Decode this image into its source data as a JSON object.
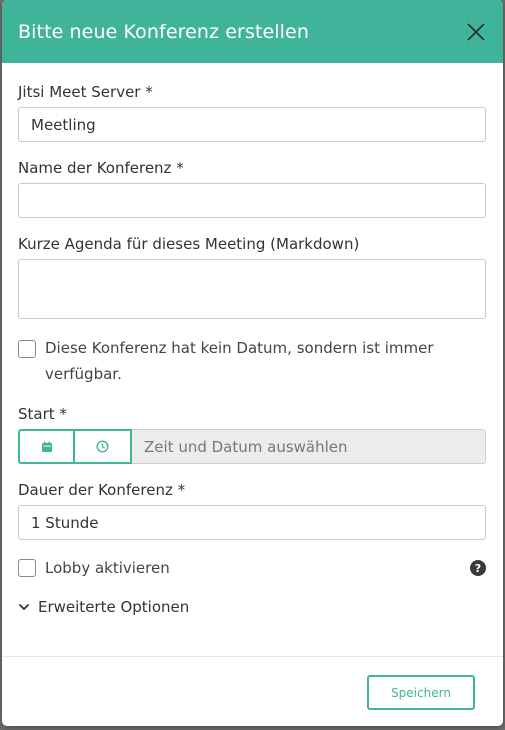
{
  "dialog": {
    "title": "Bitte neue Konferenz erstellen",
    "close_icon": "close-icon"
  },
  "form": {
    "server": {
      "label": "Jitsi Meet Server *",
      "value": "Meetling"
    },
    "name": {
      "label": "Name der Konferenz *",
      "value": ""
    },
    "agenda": {
      "label": "Kurze Agenda für dieses Meeting (Markdown)",
      "value": ""
    },
    "no_date": {
      "label": "Diese Konferenz hat kein Datum, sondern ist immer verfügbar.",
      "checked": false
    },
    "start": {
      "label": "Start *",
      "date_icon": "calendar-icon",
      "time_icon": "clock-icon",
      "placeholder": "Zeit und Datum auswählen"
    },
    "duration": {
      "label": "Dauer der Konferenz *",
      "value": "1 Stunde"
    },
    "lobby": {
      "label": "Lobby aktivieren",
      "checked": false,
      "help_icon": "question-icon",
      "help_glyph": "?"
    },
    "advanced": {
      "label": "Erweiterte Optionen",
      "icon": "chevron-down-icon"
    }
  },
  "footer": {
    "save_label": "Speichern"
  },
  "colors": {
    "accent": "#40b49a",
    "overlay": "#6f6f6f"
  }
}
